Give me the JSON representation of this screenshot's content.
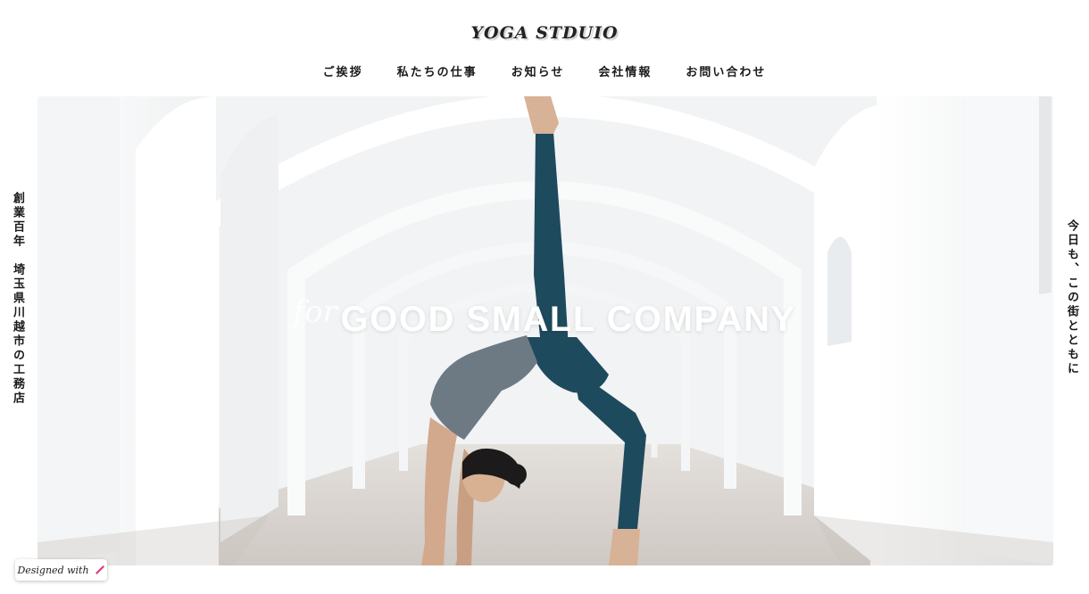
{
  "header": {
    "logo": "YOGA STDUIO"
  },
  "nav": {
    "items": [
      "ご挨拶",
      "私たちの仕事",
      "お知らせ",
      "会社情報",
      "お問い合わせ"
    ]
  },
  "hero": {
    "for_text": "for",
    "headline": "GOOD SMALL COMPANY"
  },
  "side": {
    "left": "創業百年　埼玉県川越市の工務店",
    "right": "今日も、この街とともに"
  },
  "badge": {
    "label": "Designed with"
  },
  "colors": {
    "accent": "#e0307a",
    "text": "#1a1a1a",
    "legging": "#1e4a5e"
  }
}
